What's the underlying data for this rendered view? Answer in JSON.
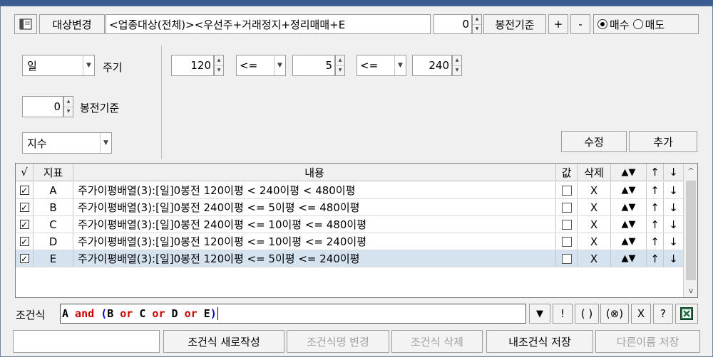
{
  "toolbar": {
    "target_change_label": "대상변경",
    "target_text": "<업종대상(전체)><우선주+거래정지+정리매매+E",
    "candle_offset": "0",
    "candle_offset_label": "봉전기준",
    "plus_label": "+",
    "minus_label": "-",
    "buy_label": "매수",
    "sell_label": "매도",
    "trade_selected": "buy"
  },
  "settings": {
    "period_value": "일",
    "period_label": "주기",
    "base_value": "0",
    "base_label": "봉전기준",
    "type_value": "지수",
    "param1": "120",
    "op1": "<=",
    "param2": "5",
    "op2": "<=",
    "param3": "240",
    "edit_label": "수정",
    "add_label": "추가"
  },
  "grid": {
    "headers": {
      "check": "√",
      "indicator": "지표",
      "content": "내용",
      "value": "값",
      "delete": "삭제",
      "updown": "▲▼",
      "up": "↑",
      "down": "↓"
    },
    "rows": [
      {
        "checked": true,
        "indicator": "A",
        "content": "주가이평배열(3):[일]0봉전  120이평 < 240이평 < 480이평",
        "delete": "X",
        "updown": "▲▼",
        "up": "↑",
        "down": "↓",
        "selected": false
      },
      {
        "checked": true,
        "indicator": "B",
        "content": "주가이평배열(3):[일]0봉전  240이평 <= 5이평 <= 480이평",
        "delete": "X",
        "updown": "▲▼",
        "up": "↑",
        "down": "↓",
        "selected": false
      },
      {
        "checked": true,
        "indicator": "C",
        "content": "주가이평배열(3):[일]0봉전  240이평 <= 10이평 <= 480이평",
        "delete": "X",
        "updown": "▲▼",
        "up": "↑",
        "down": "↓",
        "selected": false
      },
      {
        "checked": true,
        "indicator": "D",
        "content": "주가이평배열(3):[일]0봉전  120이평 <= 10이평 <= 240이평",
        "delete": "X",
        "updown": "▲▼",
        "up": "↑",
        "down": "↓",
        "selected": false
      },
      {
        "checked": true,
        "indicator": "E",
        "content": "주가이평배열(3):[일]0봉전  120이평 <= 5이평 <= 240이평",
        "delete": "X",
        "updown": "▲▼",
        "up": "↑",
        "down": "↓",
        "selected": true
      }
    ]
  },
  "expression": {
    "label": "조건식",
    "tokens": [
      {
        "text": "A",
        "kind": "var"
      },
      {
        "text": " and ",
        "kind": "op"
      },
      {
        "text": "(",
        "kind": "paren"
      },
      {
        "text": "B",
        "kind": "var"
      },
      {
        "text": " or ",
        "kind": "op"
      },
      {
        "text": "C",
        "kind": "var"
      },
      {
        "text": " or ",
        "kind": "op"
      },
      {
        "text": "D",
        "kind": "var"
      },
      {
        "text": " or ",
        "kind": "op"
      },
      {
        "text": "E",
        "kind": "var"
      },
      {
        "text": ")",
        "kind": "paren"
      }
    ],
    "buttons": {
      "dropdown": "▼",
      "not": "!",
      "paren": "( )",
      "xor": "(⊗)",
      "clear": "X",
      "help": "?"
    }
  },
  "bottom": {
    "name_value": "",
    "new_label": "조건식 새로작성",
    "rename_label": "조건식명 변경",
    "delete_label": "조건식 삭제",
    "save_label": "내조건식 저장",
    "save_as_label": "다른이름 저장"
  },
  "colors": {
    "title_bar": "#3b5c8e",
    "selected_row": "#d5e2f0",
    "operator": "#cc0000",
    "paren": "#0000cc",
    "excel_green": "#1e7145"
  }
}
